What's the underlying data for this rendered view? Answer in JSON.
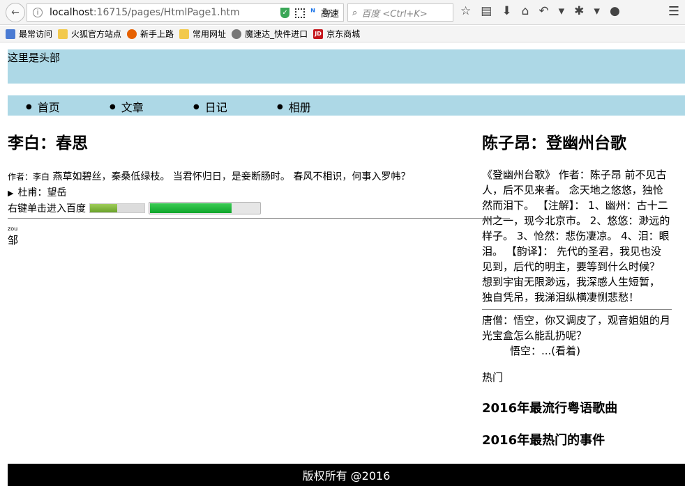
{
  "browser": {
    "url_host": "localhost",
    "url_rest": ":16715/pages/HtmlPage1.htm",
    "speed_label": "高速",
    "search_placeholder": "百度 <Ctrl+K>"
  },
  "bookmarks": [
    {
      "label": "最常访问",
      "icon": "star-icon"
    },
    {
      "label": "火狐官方站点",
      "icon": "folder-icon"
    },
    {
      "label": "新手上路",
      "icon": "firefox-icon"
    },
    {
      "label": "常用网址",
      "icon": "folder-icon"
    },
    {
      "label": "魔速达_快件进口",
      "icon": "globe-icon"
    },
    {
      "label": "京东商城",
      "icon": "jd-icon"
    }
  ],
  "header": {
    "text": "这里是头部"
  },
  "nav": {
    "items": [
      "首页",
      "文章",
      "日记",
      "相册"
    ]
  },
  "main": {
    "title": "李白：春思",
    "author_label": "作者：李白",
    "poem": "燕草如碧丝，秦桑低绿枝。 当君怀归日，是妾断肠时。 春风不相识，何事入罗帏？",
    "details_summary": "杜甫：望岳",
    "context_text": "右键单击进入百度",
    "meter_value": 0.5,
    "progress_value": 0.75,
    "ruby_rt": "zou",
    "ruby_base": "邹"
  },
  "aside": {
    "title": "陈子昂：登幽州台歌",
    "article": "《登幽州台歌》 作者：陈子昂 前不见古人，后不见来者。 念天地之悠悠，独怆然而泪下。 【注解】： 1、幽州：古十二州之一，现今北京市。 2、悠悠：渺远的样子。 3、怆然：悲伤凄凉。 4、泪：眼泪。 【韵译】： 先代的圣君，我见也没见到，后代的明主，要等到什么时候？ 想到宇宙无限渺远，我深感人生短暂， 独自凭吊，我涕泪纵横凄恻悲愁！",
    "dialog": "唐僧：悟空，你又调皮了，观音姐姐的月光宝盒怎么能乱扔呢？",
    "dialog_reply": "悟空：...(看着)",
    "hot_label": "热门",
    "hot_items": [
      "2016年最流行粤语歌曲",
      "2016年最热门的事件"
    ]
  },
  "footer": {
    "text": "版权所有 @2016"
  }
}
